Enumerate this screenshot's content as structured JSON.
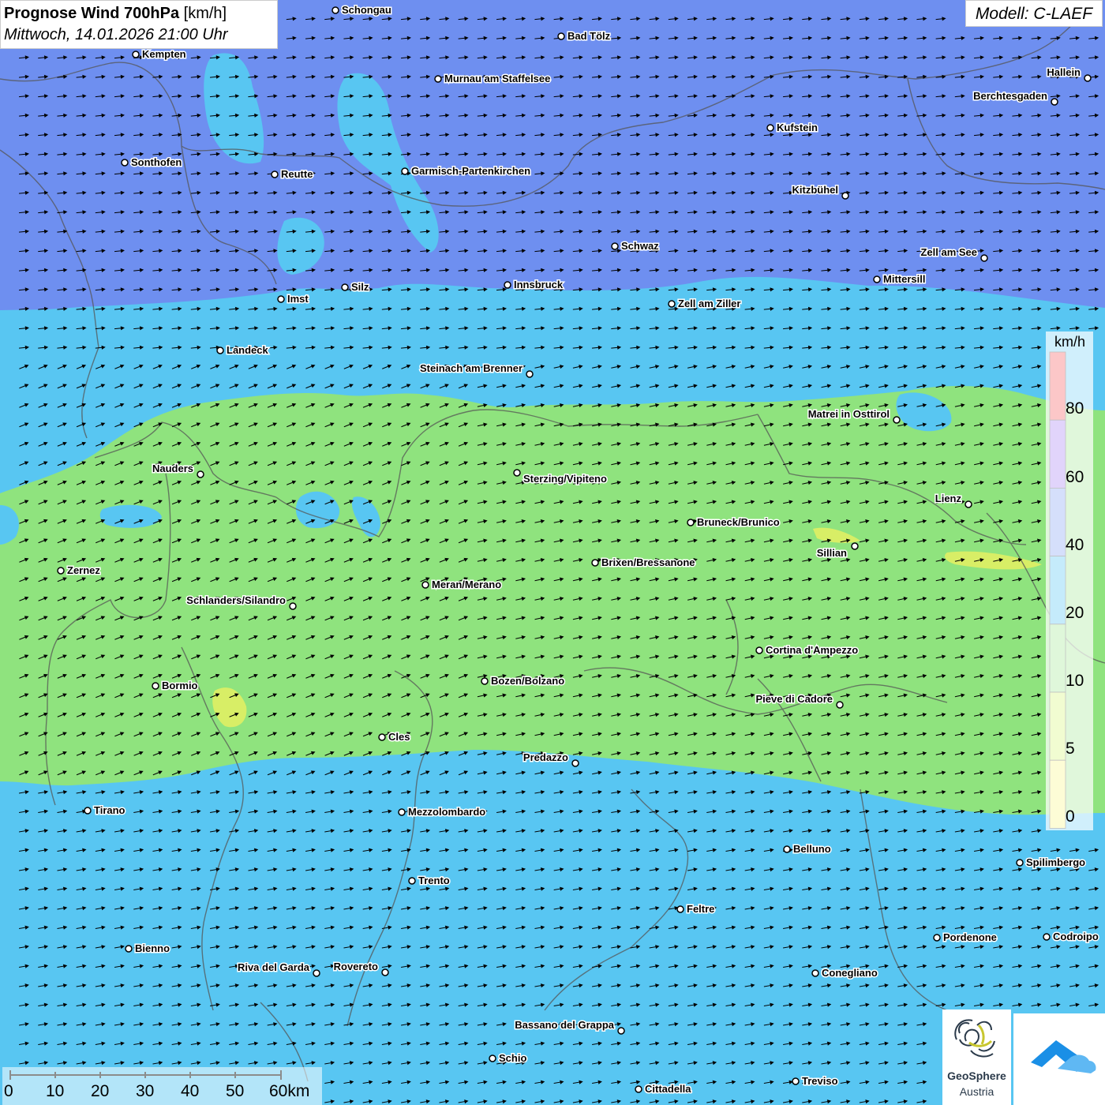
{
  "title": {
    "bold": "Prognose Wind 700hPa",
    "unit": "[km/h]",
    "datetime": "Mittwoch, 14.01.2026 21:00 Uhr"
  },
  "model": "Modell: C-LAEF",
  "legend": {
    "unit": "km/h",
    "ticks": [
      "80",
      "60",
      "40",
      "20",
      "10",
      "5",
      "0"
    ],
    "colors": [
      "#f24a44",
      "#9b6cf0",
      "#6b8cf0",
      "#2ab4ee",
      "#8ee17c",
      "#ccf25c",
      "#f6f26c"
    ],
    "bands": [
      {
        "from": 80,
        "to": 100,
        "color": "#f2383c"
      },
      {
        "from": 60,
        "to": 80,
        "color": "#9566f0"
      },
      {
        "from": 40,
        "to": 60,
        "color": "#6a8ef0"
      },
      {
        "from": 20,
        "to": 40,
        "color": "#2fb8f0"
      },
      {
        "from": 10,
        "to": 20,
        "color": "#8ee37c"
      },
      {
        "from": 5,
        "to": 10,
        "color": "#cdf25a"
      },
      {
        "from": 0,
        "to": 5,
        "color": "#f7f36c"
      }
    ]
  },
  "scale": {
    "labels": [
      "0",
      "10",
      "20",
      "30",
      "40",
      "50",
      "60km"
    ]
  },
  "logos": {
    "geosphere_name": "GeoSphere",
    "geosphere_country": "Austria"
  },
  "colors": {
    "zone_40_60": "#6e8ff0",
    "zone_20_40": "#58c6f2",
    "zone_10_20": "#8fe37e",
    "zone_5_10": "#d8ee66",
    "border": "#555555"
  },
  "cities": [
    {
      "name": "Schongau"
    },
    {
      "name": "Bad Tölz"
    },
    {
      "name": "Kempten"
    },
    {
      "name": "Murnau am Staffelsee"
    },
    {
      "name": "Hallein"
    },
    {
      "name": "Berchtesgaden"
    },
    {
      "name": "Kufstein"
    },
    {
      "name": "Sonthofen"
    },
    {
      "name": "Reutte"
    },
    {
      "name": "Garmisch-Partenkirchen"
    },
    {
      "name": "Kitzbühel"
    },
    {
      "name": "Schwaz"
    },
    {
      "name": "Zell am See"
    },
    {
      "name": "Mittersill"
    },
    {
      "name": "Imst"
    },
    {
      "name": "Silz"
    },
    {
      "name": "Innsbruck"
    },
    {
      "name": "Zell am Ziller"
    },
    {
      "name": "Landeck"
    },
    {
      "name": "Steinach am Brenner"
    },
    {
      "name": "Matrei in Osttirol"
    },
    {
      "name": "Nauders"
    },
    {
      "name": "Sterzing/Vipiteno"
    },
    {
      "name": "Lienz"
    },
    {
      "name": "Bruneck/Brunico"
    },
    {
      "name": "Sillian"
    },
    {
      "name": "Zernez"
    },
    {
      "name": "Brixen/Bressanone"
    },
    {
      "name": "Meran/Merano"
    },
    {
      "name": "Schlanders/Silandro"
    },
    {
      "name": "Cortina d'Ampezzo"
    },
    {
      "name": "Bormio"
    },
    {
      "name": "Bozen/Bolzano"
    },
    {
      "name": "Pieve di Cadore"
    },
    {
      "name": "Cles"
    },
    {
      "name": "Predazzo"
    },
    {
      "name": "Tirano"
    },
    {
      "name": "Mezzolombardo"
    },
    {
      "name": "Belluno"
    },
    {
      "name": "Spilimbergo"
    },
    {
      "name": "Trento"
    },
    {
      "name": "Feltre"
    },
    {
      "name": "Pordenone"
    },
    {
      "name": "Codroipo"
    },
    {
      "name": "Bienno"
    },
    {
      "name": "Riva del Garda"
    },
    {
      "name": "Rovereto"
    },
    {
      "name": "Conegliano"
    },
    {
      "name": "Bassano del Grappa"
    },
    {
      "name": "Schio"
    },
    {
      "name": "Treviso"
    },
    {
      "name": "Cittadella"
    }
  ]
}
